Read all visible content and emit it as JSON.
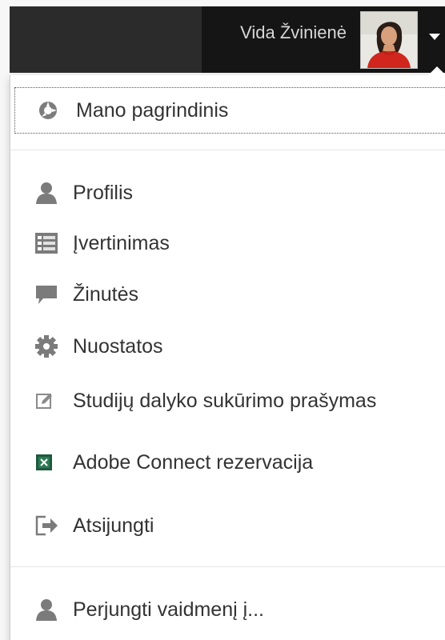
{
  "header": {
    "user_name": "Vida Žvinienė"
  },
  "icons": {
    "dashboard": "dashboard-icon",
    "profile": "user-icon",
    "grades": "grades-table-icon",
    "messages": "speech-bubble-icon",
    "preferences": "gear-icon",
    "course_request": "edit-box-icon",
    "adobe_connect": "adobe-connect-icon",
    "logout": "logout-icon",
    "switch_role": "user-icon",
    "menu_caret": "chevron-down-icon"
  },
  "menu": {
    "dashboard": "Mano pagrindinis",
    "profile": "Profilis",
    "grades": "Įvertinimas",
    "messages": "Žinutės",
    "preferences": "Nuostatos",
    "course_request": "Studijų dalyko sukūrimo prašymas",
    "adobe_connect": "Adobe Connect rezervacija",
    "logout": "Atsijungti",
    "switch_role": "Perjungti vaidmenį į..."
  }
}
